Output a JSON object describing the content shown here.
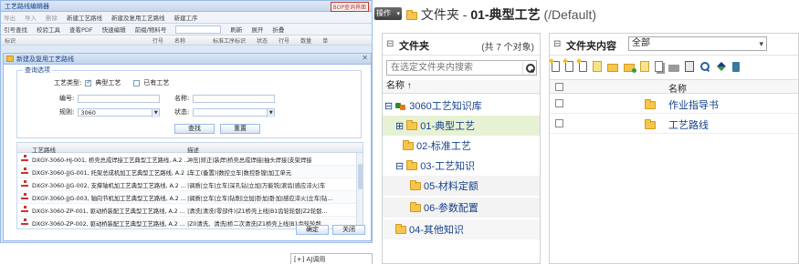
{
  "left_window": {
    "title": "工艺路线编辑器",
    "badge": "BOP查询界面",
    "toolbar": [
      "导出",
      "导入",
      "删除",
      "新建工艺路线",
      "新建及复用工艺路线",
      "新建工序"
    ],
    "toolbar2": [
      "引号查找",
      "校验工具",
      "查看PDF",
      "快速编辑",
      "刷新",
      "展开",
      "折叠"
    ],
    "toolbar2_field": "前缀/物料号",
    "columns": [
      "标识",
      "行号",
      "名称",
      "标准工序标识",
      "状态",
      "行号",
      "数量",
      "单"
    ],
    "dialog": {
      "title": "新建及复用工艺路线",
      "fieldset_legend": "查询选项",
      "type_label": "工艺类型:",
      "type_options": [
        "典型工艺",
        "已有工艺"
      ],
      "code_label": "编号:",
      "name_label": "名称:",
      "spec_label": "规则:",
      "spec_value": "3060",
      "status_label": "状态:",
      "search_btn": "查找",
      "reset_btn": "重置",
      "grid_headers": [
        "工艺路线",
        "描述"
      ],
      "rows": [
        {
          "num": "1",
          "name": "DXGY-3060-HJ-001, 桥壳总成焊接工艺典型工艺路线, A.2 ...",
          "desc": "冲压|矫正|装焊|桥壳总成焊接|抽头焊接|支架焊接"
        },
        {
          "num": "2",
          "name": "DXGY-3060-JJG-001, 托架总成机加工艺典型工艺路线, A.2 ...",
          "desc": "|车工(备置)|数控立车|数控卧镗|加工单元"
        },
        {
          "num": "3",
          "name": "DXGY-3060-JJG-002, 支撑轴机加工艺典型工艺路线, A.2 ...",
          "desc": "|调质|立车|立车|深孔钻|立加|万能铣|滚齿|感应淬火|车"
        },
        {
          "num": "4",
          "name": "DXGY-3060-JJG-003, 轴向节机加工艺典型工艺路线, A.2 ...",
          "desc": "|调质|立车|立车|钻削|立加|卧加|卧加|感应淬火|立车|钻..."
        },
        {
          "num": "5",
          "name": "DXGY-3060-ZP-001, 驱动桥装配工艺典型工艺路线, A.2 ...",
          "desc": "|清洗|清洗(零部件)|Z1桥壳上线|B1齿轮轮毂|Z2轮毂..."
        },
        {
          "num": "6",
          "name": "DXGY-3060-ZP-002, 驱动桥装配工艺典型工艺路线, A.2 ...",
          "desc": "|Z0清洗、清洗|桥二次清洗|Z1桥壳上线|B1齿轮轮毂..."
        }
      ],
      "ok_btn": "确定",
      "close_btn": "关闭"
    }
  },
  "snippet_text": "[+] AJ调用",
  "topbar": {
    "op_button": "操作",
    "path_prefix": "文件夹 - ",
    "current_folder": "01-典型工艺",
    "path_tail": " (/Default)"
  },
  "tree_panel": {
    "title": "文件夹",
    "count": "(共 7 个对象)",
    "search_placeholder": "在选定文件夹内搜索",
    "column": "名称 ↑",
    "nodes": [
      {
        "label": "3060工艺知识库",
        "exp": "⊟"
      },
      {
        "label": "01-典型工艺",
        "exp": "⊞"
      },
      {
        "label": "02-标准工艺",
        "exp": ""
      },
      {
        "label": "03-工艺知识",
        "exp": "⊟"
      },
      {
        "label": "05-材料定额",
        "exp": ""
      },
      {
        "label": "06-参数配置",
        "exp": ""
      },
      {
        "label": "04-其他知识",
        "exp": ""
      }
    ]
  },
  "content_panel": {
    "title": "文件夹内容",
    "filter": "全部",
    "column": "名称",
    "items": [
      "作业指导书",
      "工艺路线"
    ]
  }
}
